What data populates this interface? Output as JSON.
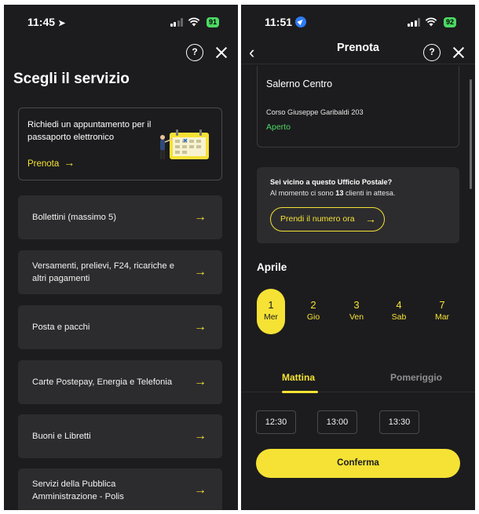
{
  "colors": {
    "background": "#1c1c1e",
    "card": "#2c2c2e",
    "accent": "#f5e235",
    "open_green": "#4cd964"
  },
  "left": {
    "status": {
      "time": "11:45",
      "battery": "91"
    },
    "title": "Scegli il servizio",
    "promo": {
      "text": "Richiedi un appuntamento per il passaporto elettronico",
      "link": "Prenota"
    },
    "services": [
      {
        "label": "Bollettini (massimo 5)"
      },
      {
        "label": "Versamenti, prelievi, F24, ricariche e altri pagamenti"
      },
      {
        "label": "Posta e pacchi"
      },
      {
        "label": "Carte Postepay, Energia e Telefonia"
      },
      {
        "label": "Buoni e Libretti"
      },
      {
        "label": "Servizi della Pubblica Amministrazione - Polis"
      }
    ]
  },
  "right": {
    "status": {
      "time": "11:51",
      "battery": "92"
    },
    "title": "Prenota",
    "office": {
      "name": "Salerno Centro",
      "address": "Corso Giuseppe Garibaldi 203",
      "status": "Aperto"
    },
    "queue": {
      "heading": "Sei vicino a questo Ufficio Postale?",
      "text_before": "Al momento ci sono ",
      "count": "13",
      "text_after": " clienti in attesa.",
      "button": "Prendi il numero ora"
    },
    "month": "Aprile",
    "days": [
      {
        "num": "1",
        "weekday": "Mer",
        "selected": true
      },
      {
        "num": "2",
        "weekday": "Gio",
        "selected": false
      },
      {
        "num": "3",
        "weekday": "Ven",
        "selected": false
      },
      {
        "num": "4",
        "weekday": "Sab",
        "selected": false
      },
      {
        "num": "7",
        "weekday": "Mar",
        "selected": false
      }
    ],
    "tabs": {
      "morning": "Mattina",
      "afternoon": "Pomeriggio"
    },
    "slots": [
      "12:30",
      "13:00",
      "13:30"
    ],
    "confirm": "Conferma"
  }
}
